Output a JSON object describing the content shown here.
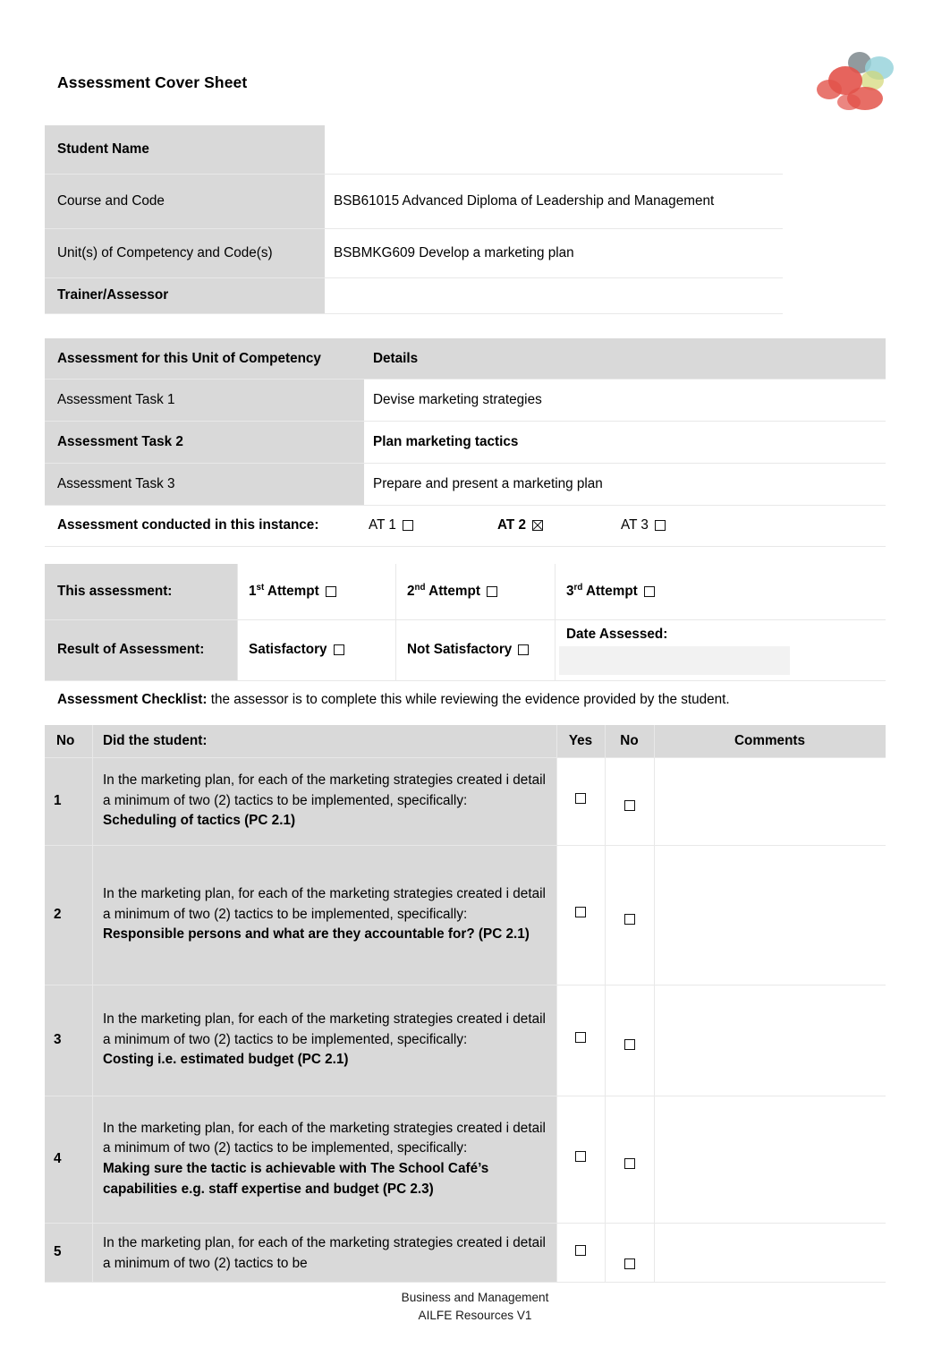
{
  "document": {
    "title": "Assessment Cover Sheet",
    "logo_icon": "organisation-logo"
  },
  "student_details": {
    "rows": [
      {
        "label": "Student Name",
        "value": "",
        "bold": true
      },
      {
        "label": "Course and Code",
        "value": "BSB61015 Advanced Diploma of Leadership and Management",
        "bold": false
      },
      {
        "label": "Unit(s) of Competency and Code(s)",
        "value": "BSBMKG609 Develop a marketing plan",
        "bold": false
      },
      {
        "label": "Trainer/Assessor",
        "value": "",
        "bold": true
      }
    ]
  },
  "assessment_tasks": {
    "header_left": "Assessment for this Unit of Competency",
    "header_right": "Details",
    "rows": [
      {
        "label": "Assessment Task 1",
        "detail": "Devise marketing strategies",
        "bold": false
      },
      {
        "label": "Assessment Task 2",
        "detail": "Plan marketing tactics",
        "bold": true
      },
      {
        "label": "Assessment Task 3",
        "detail": "Prepare and present a marketing plan",
        "bold": false
      }
    ],
    "conducted_label": "Assessment conducted in this instance:",
    "conducted_options": [
      {
        "label": "AT 1",
        "checked": false,
        "bold": false
      },
      {
        "label": "AT 2",
        "checked": true,
        "bold": true
      },
      {
        "label": "AT 3",
        "checked": false,
        "bold": false
      }
    ]
  },
  "attempt_result": {
    "this_assessment_label": "This assessment:",
    "attempts": [
      {
        "ordinal": "1",
        "suffix": "st",
        "label": "Attempt",
        "checked": false
      },
      {
        "ordinal": "2",
        "suffix": "nd",
        "label": "Attempt",
        "checked": false
      },
      {
        "ordinal": "3",
        "suffix": "rd",
        "label": "Attempt",
        "checked": false
      }
    ],
    "result_label": "Result of Assessment:",
    "results": [
      {
        "label": "Satisfactory",
        "checked": false
      },
      {
        "label": "Not Satisfactory",
        "checked": false
      }
    ],
    "date_assessed_label": "Date Assessed:",
    "date_assessed_value": ""
  },
  "checklist": {
    "note_bold": "Assessment Checklist:",
    "note_rest": " the assessor is to complete this while reviewing the evidence provided by the student.",
    "headers": {
      "no": "No",
      "question": "Did the student:",
      "yes": "Yes",
      "no_col": "No",
      "comments": "Comments"
    },
    "rows": [
      {
        "no": "1",
        "intro": "In the marketing plan, for each of the marketing strategies created i detail a minimum of two (2) tactics to be implemented, specifically:",
        "emphasis": "Scheduling of tactics (PC 2.1)",
        "yes_checked": false,
        "no_checked": false,
        "comment": ""
      },
      {
        "no": "2",
        "intro": "In the marketing plan, for each of the marketing strategies created i detail a minimum of two (2) tactics to be implemented, specifically:",
        "emphasis": "Responsible persons and what are they accountable for? (PC 2.1)",
        "yes_checked": false,
        "no_checked": false,
        "comment": ""
      },
      {
        "no": "3",
        "intro": "In the marketing plan, for each of the marketing strategies created i detail a minimum of two (2) tactics to be implemented, specifically:",
        "emphasis": "Costing i.e. estimated budget (PC 2.1)",
        "yes_checked": false,
        "no_checked": false,
        "comment": ""
      },
      {
        "no": "4",
        "intro": "In the marketing plan, for each of the marketing strategies created i detail a minimum of two (2) tactics to be implemented, specifically:",
        "emphasis": "Making sure the tactic is achievable with The School Café’s capabilities e.g. staff expertise and budget (PC 2.3)",
        "yes_checked": false,
        "no_checked": false,
        "comment": ""
      },
      {
        "no": "5",
        "intro": "In the marketing plan, for each of the marketing strategies created i detail a minimum of two (2) tactics to be",
        "emphasis": "",
        "yes_checked": false,
        "no_checked": false,
        "comment": ""
      }
    ]
  },
  "footer": {
    "line1": "Business and Management",
    "line2": "AILFE Resources V1"
  },
  "colors": {
    "shade": "#d9d9d9",
    "page": "#ffffff",
    "line": "#e8e8e8"
  }
}
